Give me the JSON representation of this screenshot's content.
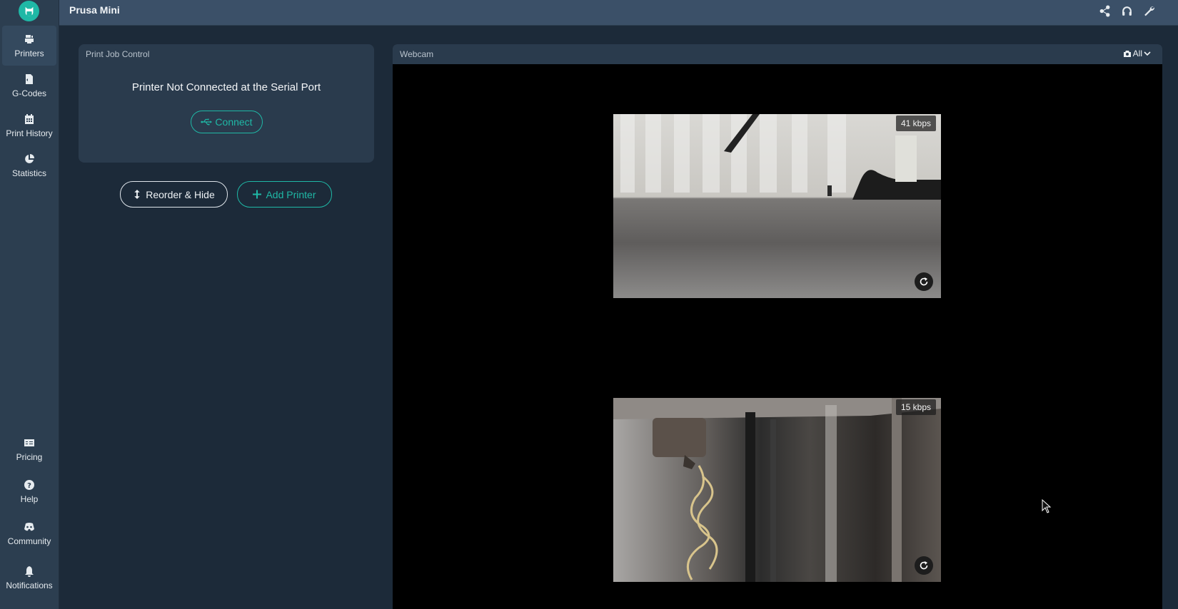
{
  "app": {
    "title": "Prusa Mini"
  },
  "sidebar": {
    "items": [
      {
        "label": "Printers",
        "icon": "printer-icon"
      },
      {
        "label": "G-Codes",
        "icon": "gcode-file-icon"
      },
      {
        "label": "Print History",
        "icon": "calendar-icon"
      },
      {
        "label": "Statistics",
        "icon": "pie-chart-icon"
      }
    ],
    "bottom_items": [
      {
        "label": "Pricing",
        "icon": "price-card-icon"
      },
      {
        "label": "Help",
        "icon": "help-icon"
      },
      {
        "label": "Community",
        "icon": "discord-icon"
      },
      {
        "label": "Notifications",
        "icon": "bell-icon"
      }
    ]
  },
  "topbar": {
    "icons": [
      "share-icon",
      "headphones-icon",
      "wrench-icon"
    ]
  },
  "print_job": {
    "header": "Print Job Control",
    "status": "Printer Not Connected at the Serial Port",
    "connect_label": "Connect"
  },
  "actions": {
    "reorder_label": "Reorder & Hide",
    "add_printer_label": "Add Printer"
  },
  "webcam": {
    "header": "Webcam",
    "select_label": "All",
    "feeds": [
      {
        "bitrate": "41 kbps"
      },
      {
        "bitrate": "15 kbps"
      }
    ]
  },
  "colors": {
    "accent": "#1fb8a6",
    "sidebar": "#2c3e50",
    "background": "#1c2a39",
    "topbar": "#3b5068",
    "card": "#2a3b4d"
  }
}
